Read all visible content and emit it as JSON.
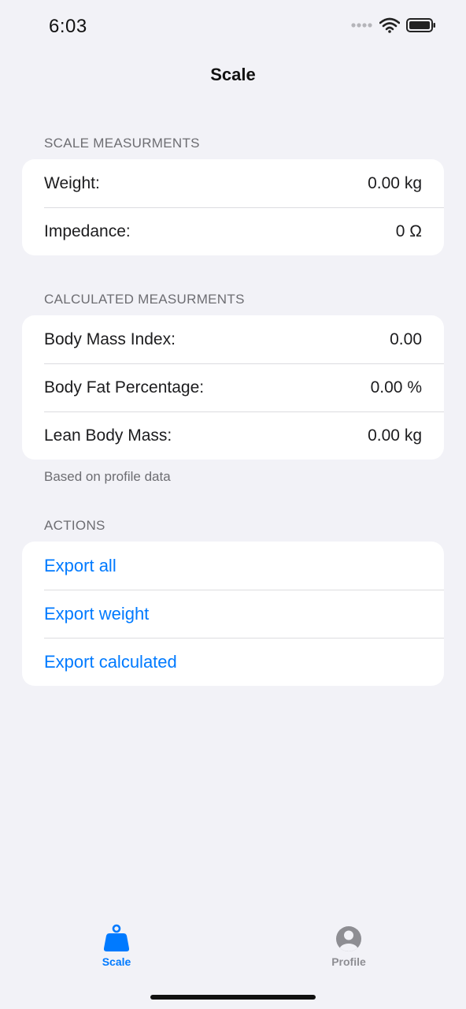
{
  "status_bar": {
    "time": "6:03"
  },
  "nav": {
    "title": "Scale"
  },
  "sections": {
    "scale": {
      "header": "SCALE MEASURMENTS",
      "rows": [
        {
          "label": "Weight:",
          "value": "0.00 kg"
        },
        {
          "label": "Impedance:",
          "value": "0 Ω"
        }
      ]
    },
    "calculated": {
      "header": "CALCULATED MEASURMENTS",
      "rows": [
        {
          "label": "Body Mass Index:",
          "value": "0.00"
        },
        {
          "label": "Body Fat Percentage:",
          "value": "0.00 %"
        },
        {
          "label": "Lean Body Mass:",
          "value": "0.00 kg"
        }
      ],
      "footer": "Based on profile data"
    },
    "actions": {
      "header": "ACTIONS",
      "items": [
        "Export all",
        "Export weight",
        "Export calculated"
      ]
    }
  },
  "tab_bar": {
    "tabs": [
      {
        "label": "Scale",
        "icon": "scale-weight-icon",
        "selected": true
      },
      {
        "label": "Profile",
        "icon": "person-circle-icon",
        "selected": false
      }
    ]
  },
  "colors": {
    "accent": "#007aff",
    "background": "#f2f2f7",
    "inactive": "#8e8e93"
  }
}
